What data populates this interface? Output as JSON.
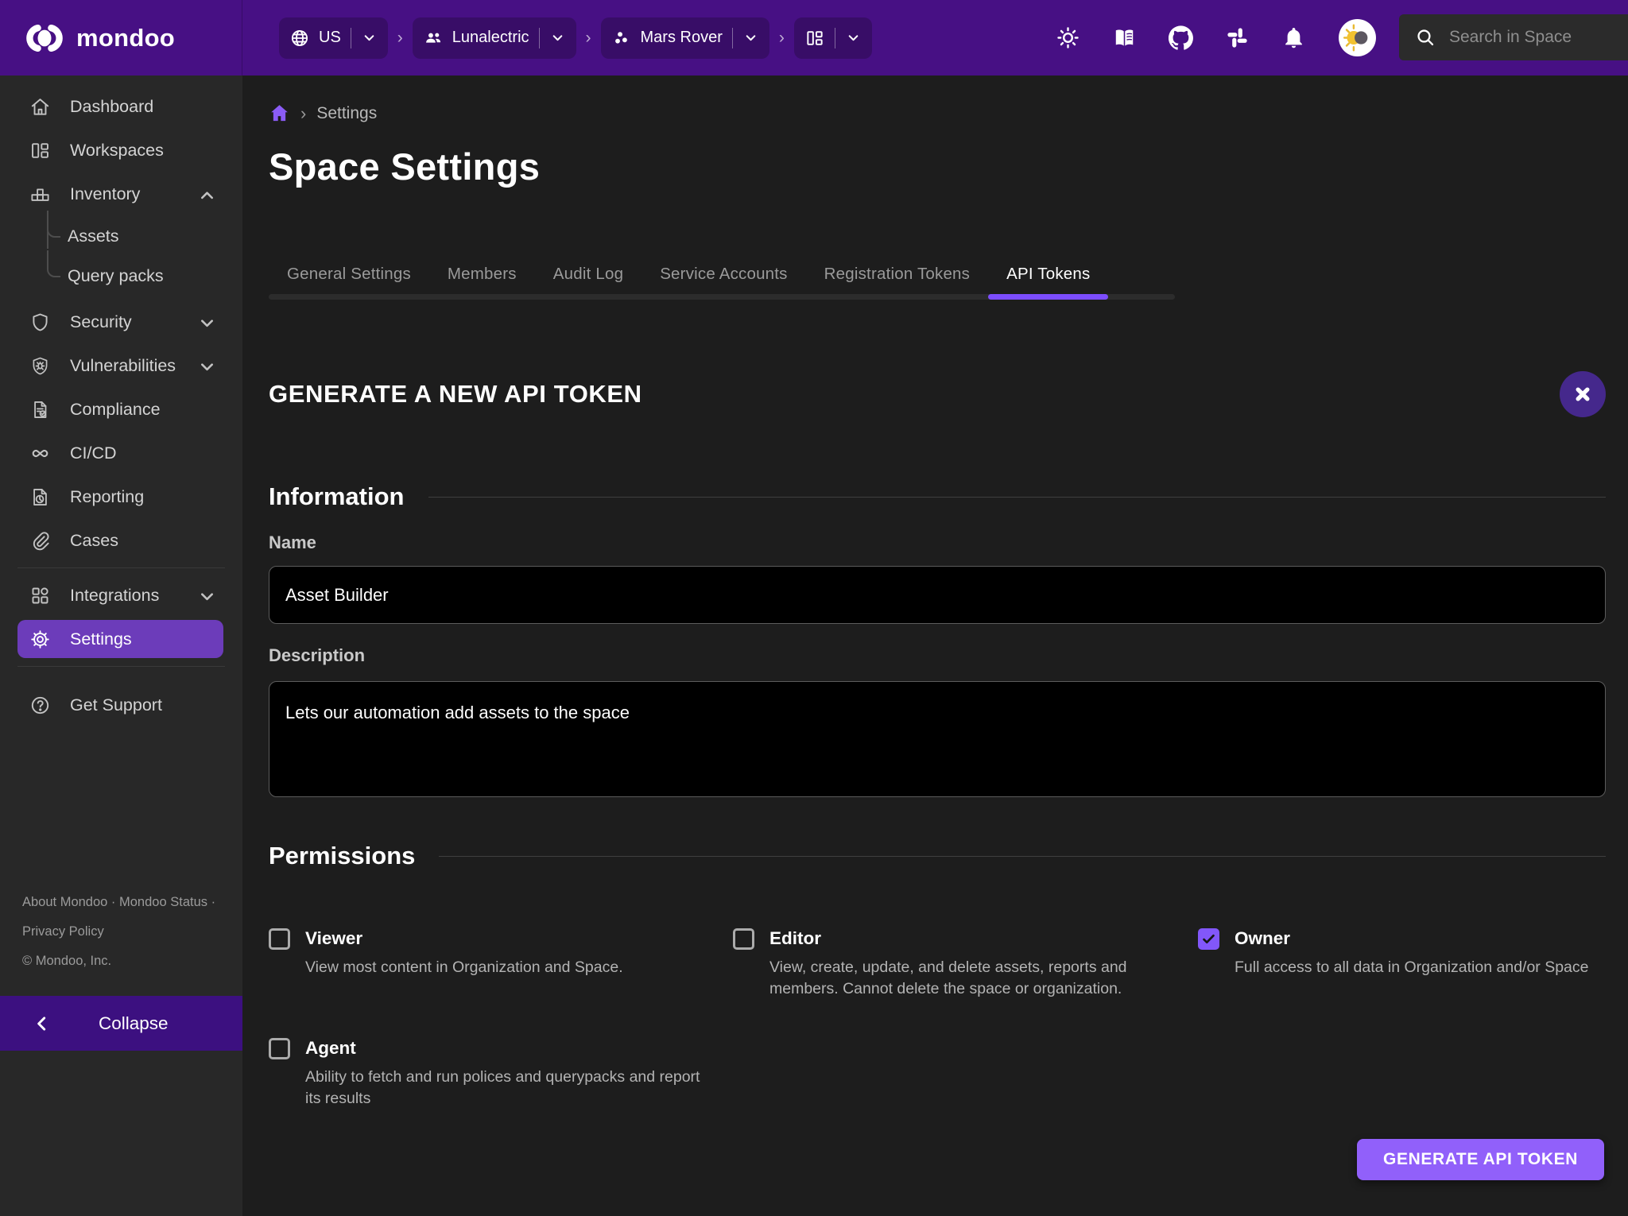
{
  "topbar": {
    "logo_text": "mondoo",
    "context_chips": [
      {
        "id": "region-selector",
        "icon": "globe-icon",
        "label": "US"
      },
      {
        "id": "org-selector",
        "icon": "people-icon",
        "label": "Lunalectric"
      },
      {
        "id": "space-selector",
        "icon": "space-dots-icon",
        "label": "Mars Rover"
      },
      {
        "id": "workspace-selector",
        "icon": "workspace-grid-icon",
        "label": ""
      }
    ],
    "action_icons": [
      {
        "id": "theme-toggle-button",
        "icon": "sun-icon"
      },
      {
        "id": "docs-button",
        "icon": "book-icon"
      },
      {
        "id": "github-button",
        "icon": "github-icon"
      },
      {
        "id": "slack-button",
        "icon": "slack-icon"
      },
      {
        "id": "notifications-button",
        "icon": "bell-icon"
      }
    ],
    "search_placeholder": "Search in Space"
  },
  "sidebar": {
    "items": [
      {
        "id": "dashboard",
        "label": "Dashboard",
        "icon": "home-icon"
      },
      {
        "id": "workspaces",
        "label": "Workspaces",
        "icon": "workspaces-icon"
      },
      {
        "id": "inventory",
        "label": "Inventory",
        "icon": "inventory-icon",
        "expandable": true,
        "expanded": true,
        "children": [
          {
            "id": "assets",
            "label": "Assets"
          },
          {
            "id": "query-packs",
            "label": "Query packs"
          }
        ]
      },
      {
        "id": "security",
        "label": "Security",
        "icon": "shield-icon",
        "expandable": true,
        "expanded": false
      },
      {
        "id": "vulnerabilities",
        "label": "Vulnerabilities",
        "icon": "shield-bug-icon",
        "expandable": true,
        "expanded": false
      },
      {
        "id": "compliance",
        "label": "Compliance",
        "icon": "compliance-icon"
      },
      {
        "id": "cicd",
        "label": "CI/CD",
        "icon": "infinity-icon"
      },
      {
        "id": "reporting",
        "label": "Reporting",
        "icon": "report-icon"
      },
      {
        "id": "cases",
        "label": "Cases",
        "icon": "paperclip-icon"
      },
      {
        "divider": true
      },
      {
        "id": "integrations",
        "label": "Integrations",
        "icon": "integrations-icon",
        "expandable": true,
        "expanded": false
      },
      {
        "id": "settings",
        "label": "Settings",
        "icon": "gear-icon",
        "active": true
      },
      {
        "divider": true
      },
      {
        "id": "get-support",
        "label": "Get Support",
        "icon": "help-icon",
        "gap_before": true
      }
    ],
    "footer": {
      "links": [
        "About Mondoo",
        "Mondoo Status",
        "Privacy Policy"
      ],
      "copyright": "© Mondoo, Inc."
    },
    "collapse_label": "Collapse"
  },
  "breadcrumb": {
    "current_page": "Settings"
  },
  "page_title": "Space Settings",
  "tabs": [
    {
      "label": "General Settings",
      "active": false
    },
    {
      "label": "Members",
      "active": false
    },
    {
      "label": "Audit Log",
      "active": false
    },
    {
      "label": "Service Accounts",
      "active": false
    },
    {
      "label": "Registration Tokens",
      "active": false
    },
    {
      "label": "API Tokens",
      "active": true
    }
  ],
  "panel": {
    "title": "GENERATE A NEW API TOKEN",
    "information": {
      "section_title": "Information",
      "name_label": "Name",
      "name_value": "Asset Builder",
      "description_label": "Description",
      "description_value": "Lets our automation add assets to the space"
    },
    "permissions": {
      "section_title": "Permissions",
      "options": [
        {
          "id": "viewer",
          "label": "Viewer",
          "checked": false,
          "description": "View most content in Organization and Space."
        },
        {
          "id": "editor",
          "label": "Editor",
          "checked": false,
          "description": "View, create, update, and delete assets, reports and members. Cannot delete the space or organization."
        },
        {
          "id": "owner",
          "label": "Owner",
          "checked": true,
          "description": "Full access to all data in Organization and/or Space"
        },
        {
          "id": "agent",
          "label": "Agent",
          "checked": false,
          "description": "Ability to fetch and run polices and querypacks and report its results"
        }
      ]
    },
    "submit_label": "GENERATE API TOKEN"
  },
  "colors": {
    "topbar": "#471084",
    "chip": "#380d67",
    "sidebar": "#282828",
    "main_background": "#1d1d1d",
    "active_nav": "#6c3cba",
    "collapse_bar": "#3c1080",
    "tab_underline": "#7c4dff",
    "checkbox_checked": "#8257fa",
    "submit_button": "#9160fa",
    "close_button": "#45288c",
    "input_background": "#000000"
  }
}
